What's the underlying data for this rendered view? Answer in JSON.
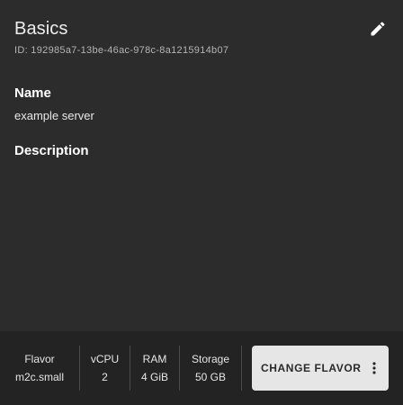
{
  "card": {
    "title": "Basics",
    "id_text": "ID: 192985a7-13be-46ac-978c-8a1215914b07"
  },
  "icons": {
    "edit": "pencil-icon",
    "more": "more-vertical-icon"
  },
  "fields": {
    "name_label": "Name",
    "name_value": "example server",
    "description_label": "Description",
    "description_value": ""
  },
  "flavor": {
    "flavor_label": "Flavor",
    "flavor_value": "m2c.small",
    "vcpu_label": "vCPU",
    "vcpu_value": "2",
    "ram_label": "RAM",
    "ram_value": "4 GiB",
    "storage_label": "Storage",
    "storage_value": "50 GB",
    "change_button": "CHANGE FLAVOR"
  }
}
